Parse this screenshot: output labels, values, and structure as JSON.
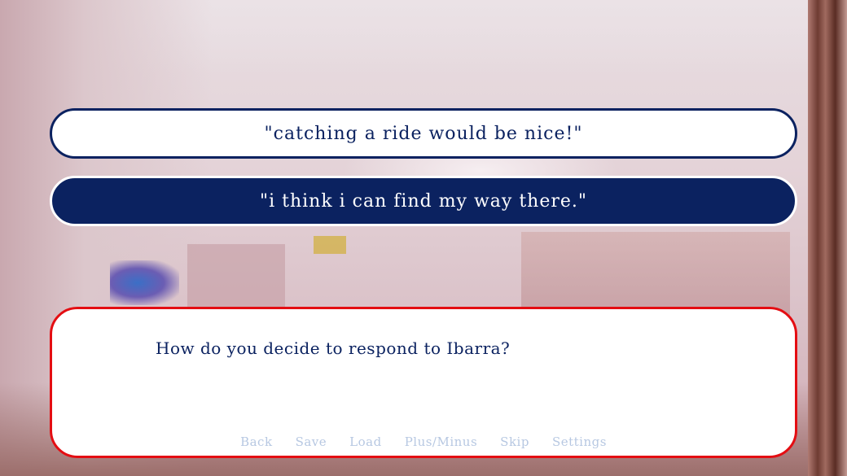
{
  "choices": [
    {
      "label": "\"catching a ride would be nice!\""
    },
    {
      "label": "\"i think i can find my way there.\""
    }
  ],
  "dialogue": {
    "text": "How do you decide to respond to Ibarra?"
  },
  "quick_menu": {
    "back": "Back",
    "save": "Save",
    "load": "Load",
    "plus_minus": "Plus/Minus",
    "skip": "Skip",
    "settings": "Settings"
  },
  "colors": {
    "navy": "#0b2260",
    "textbox_border": "#e40d12",
    "quick_menu_text": "#b7c8e2"
  }
}
